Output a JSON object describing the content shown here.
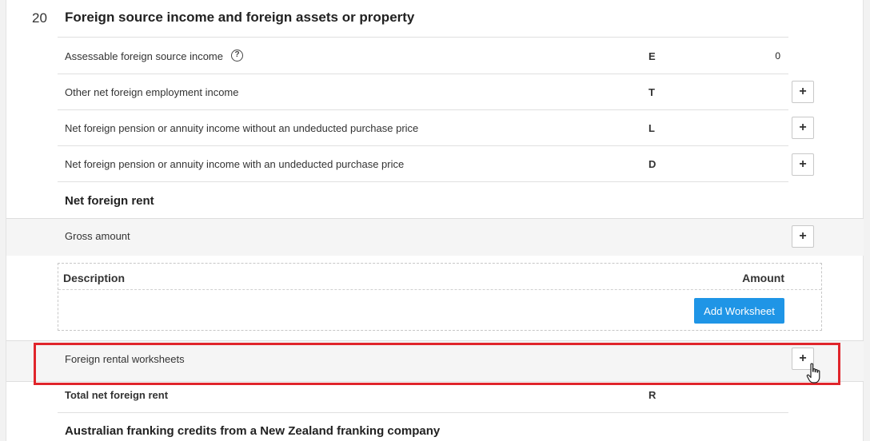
{
  "section": {
    "number": "20",
    "title": "Foreign source income and foreign assets or property"
  },
  "rows": [
    {
      "label": "Assessable foreign source income",
      "code": "E",
      "value": "0",
      "has_help": true
    },
    {
      "label": "Other net foreign employment income",
      "code": "T",
      "add_label": "+"
    },
    {
      "label": "Net foreign pension or annuity income without an undeducted purchase price",
      "code": "L",
      "add_label": "+"
    },
    {
      "label": "Net foreign pension or annuity income with an undeducted purchase price",
      "code": "D",
      "add_label": "+"
    }
  ],
  "help_icon_glyph": "?",
  "net_foreign_rent": {
    "heading": "Net foreign rent",
    "gross_amount_label": "Gross amount",
    "gross_add_label": "+",
    "worksheet_table": {
      "col_description": "Description",
      "col_amount": "Amount",
      "add_worksheet_label": "Add Worksheet"
    },
    "foreign_rental_worksheets_label": "Foreign rental worksheets",
    "foreign_rental_add_label": "+",
    "total_label": "Total net foreign rent",
    "total_code": "R"
  },
  "next_section_heading": "Australian franking credits from a New Zealand franking company",
  "colors": {
    "accent_button": "#1f95e6",
    "highlight_border": "#e0252b"
  },
  "icons": [
    "help-icon",
    "plus-icon",
    "hand-cursor-icon"
  ]
}
